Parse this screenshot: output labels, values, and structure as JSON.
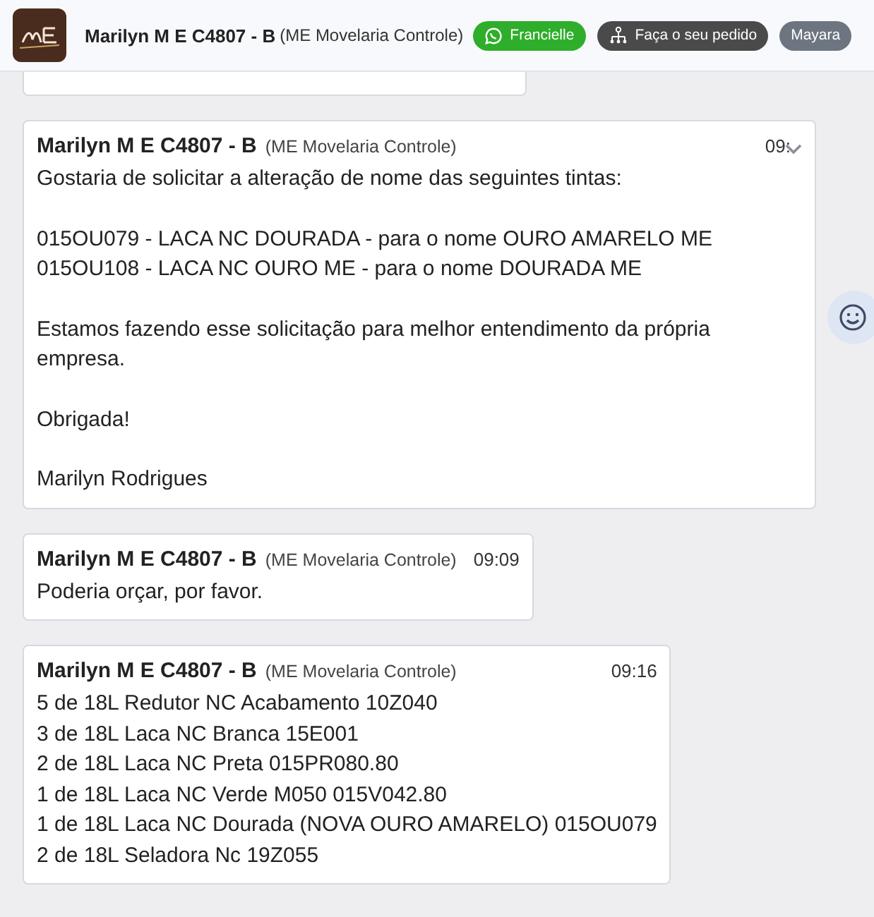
{
  "header": {
    "contact": "Marilyn M E C4807 - B",
    "org": "(ME Movelaria Controle)",
    "tags": [
      {
        "kind": "whatsapp",
        "label": "Francielle"
      },
      {
        "kind": "order",
        "label": "Faça o seu pedido"
      },
      {
        "kind": "plain",
        "label": "Mayara"
      }
    ]
  },
  "messages": [
    {
      "kind": "cut_off"
    },
    {
      "sender": "Marilyn M E C4807 - B",
      "org": "(ME Movelaria Controle)",
      "time": "09:",
      "hovered": true,
      "paragraphs": [
        [
          "Gostaria de solicitar a alteração de nome das seguintes tintas:"
        ],
        [
          "015OU079 - LACA NC DOURADA - para o nome OURO AMARELO ME",
          "015OU108 - LACA NC OURO ME - para o nome DOURADA ME"
        ],
        [
          "Estamos fazendo esse solicitação para melhor entendimento da própria empresa."
        ],
        [
          "Obrigada!"
        ],
        [
          "Marilyn Rodrigues"
        ]
      ]
    },
    {
      "sender": "Marilyn M E C4807 - B",
      "org": "(ME Movelaria Controle)",
      "time": "09:09",
      "hovered": false,
      "paragraphs": [
        [
          "Poderia orçar, por favor."
        ]
      ]
    },
    {
      "sender": "Marilyn M E C4807 - B",
      "org": "(ME Movelaria Controle)",
      "time": "09:16",
      "hovered": false,
      "paragraphs": [
        [
          "5 de 18L Redutor NC Acabamento 10Z040",
          "3 de 18L Laca NC Branca 15E001",
          "2 de 18L Laca NC Preta 015PR080.80",
          "1 de 18L Laca NC Verde M050 015V042.80",
          "1 de 18L Laca NC Dourada (NOVA OURO AMARELO) 015OU079",
          "2 de 18L Seladora Nc 19Z055"
        ]
      ]
    }
  ]
}
